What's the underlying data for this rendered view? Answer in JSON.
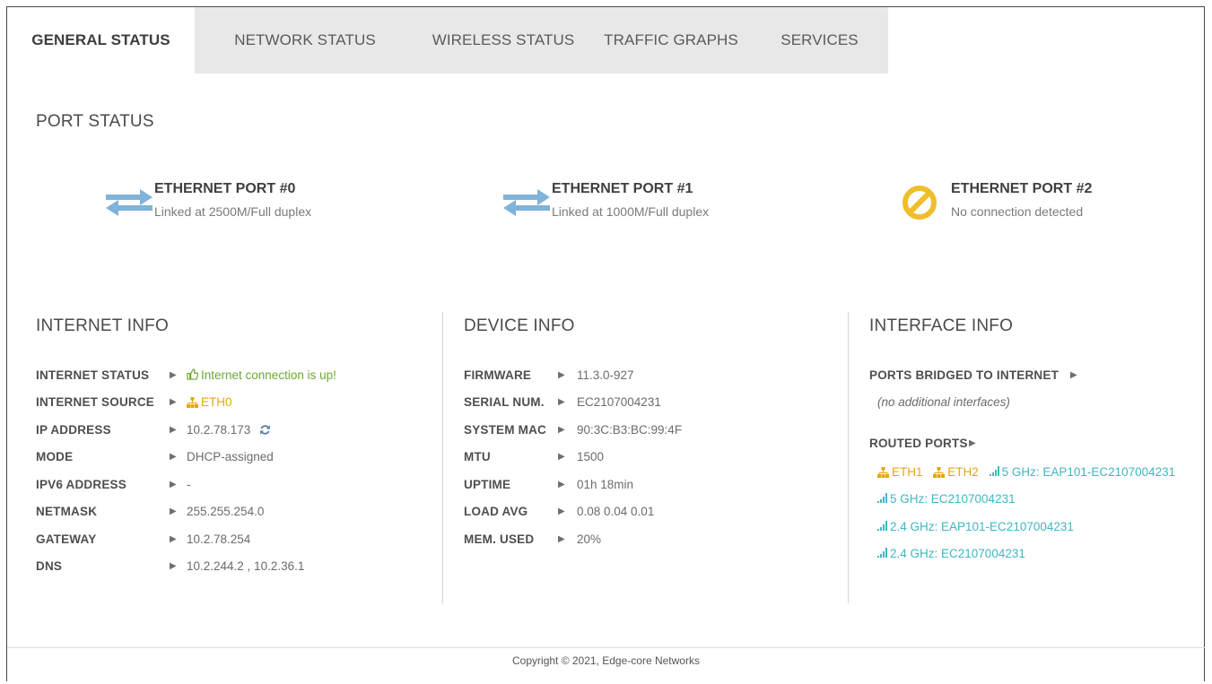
{
  "tabs": [
    {
      "label": "GENERAL STATUS",
      "active": true
    },
    {
      "label": "NETWORK STATUS",
      "active": false
    },
    {
      "label": "WIRELESS STATUS",
      "active": false
    },
    {
      "label": "TRAFFIC GRAPHS",
      "active": false
    },
    {
      "label": "SERVICES",
      "active": false
    }
  ],
  "port_status": {
    "title": "PORT STATUS",
    "ports": [
      {
        "name": "ETHERNET PORT #0",
        "status": "Linked at 2500M/Full duplex",
        "icon": "transfer-arrows-icon"
      },
      {
        "name": "ETHERNET PORT #1",
        "status": "Linked at 1000M/Full duplex",
        "icon": "transfer-arrows-icon"
      },
      {
        "name": "ETHERNET PORT #2",
        "status": "No connection detected",
        "icon": "no-connection-icon"
      }
    ]
  },
  "internet_info": {
    "title": "INTERNET INFO",
    "rows": [
      {
        "key": "INTERNET STATUS",
        "value": "Internet connection is up!"
      },
      {
        "key": "INTERNET SOURCE",
        "value": "ETH0"
      },
      {
        "key": "IP ADDRESS",
        "value": "10.2.78.173"
      },
      {
        "key": "MODE",
        "value": "DHCP-assigned"
      },
      {
        "key": "IPV6 ADDRESS",
        "value": "-"
      },
      {
        "key": "NETMASK",
        "value": "255.255.254.0"
      },
      {
        "key": "GATEWAY",
        "value": "10.2.78.254"
      },
      {
        "key": "DNS",
        "value": "10.2.244.2 , 10.2.36.1"
      }
    ]
  },
  "device_info": {
    "title": "DEVICE INFO",
    "rows": [
      {
        "key": "FIRMWARE",
        "value": "11.3.0-927"
      },
      {
        "key": "SERIAL NUM.",
        "value": "EC2107004231"
      },
      {
        "key": "SYSTEM MAC",
        "value": "90:3C:B3:BC:99:4F"
      },
      {
        "key": "MTU",
        "value": "1500"
      },
      {
        "key": "UPTIME",
        "value": "01h 18min"
      },
      {
        "key": "LOAD AVG",
        "value": "0.08 0.04 0.01"
      },
      {
        "key": "MEM. USED",
        "value": "20%"
      }
    ]
  },
  "interface_info": {
    "title": "INTERFACE INFO",
    "bridged_label": "PORTS BRIDGED TO INTERNET",
    "bridged_none": "(no additional interfaces)",
    "routed_label": "ROUTED PORTS",
    "routed": {
      "eth1": "ETH1",
      "eth2": "ETH2",
      "wlan1": "5 GHz: EAP101-EC2107004231",
      "wlan2": "5 GHz: EC2107004231",
      "wlan3": "2.4 GHz: EAP101-EC2107004231",
      "wlan4": "2.4 GHz: EC2107004231"
    }
  },
  "footer": "Copyright © 2021, Edge-core Networks",
  "colors": {
    "green": "#6aa832",
    "orange": "#e8a60c",
    "teal": "#3fb7c3",
    "arrow_blue": "#7fb3d9",
    "warning_yellow": "#f0be2a"
  }
}
